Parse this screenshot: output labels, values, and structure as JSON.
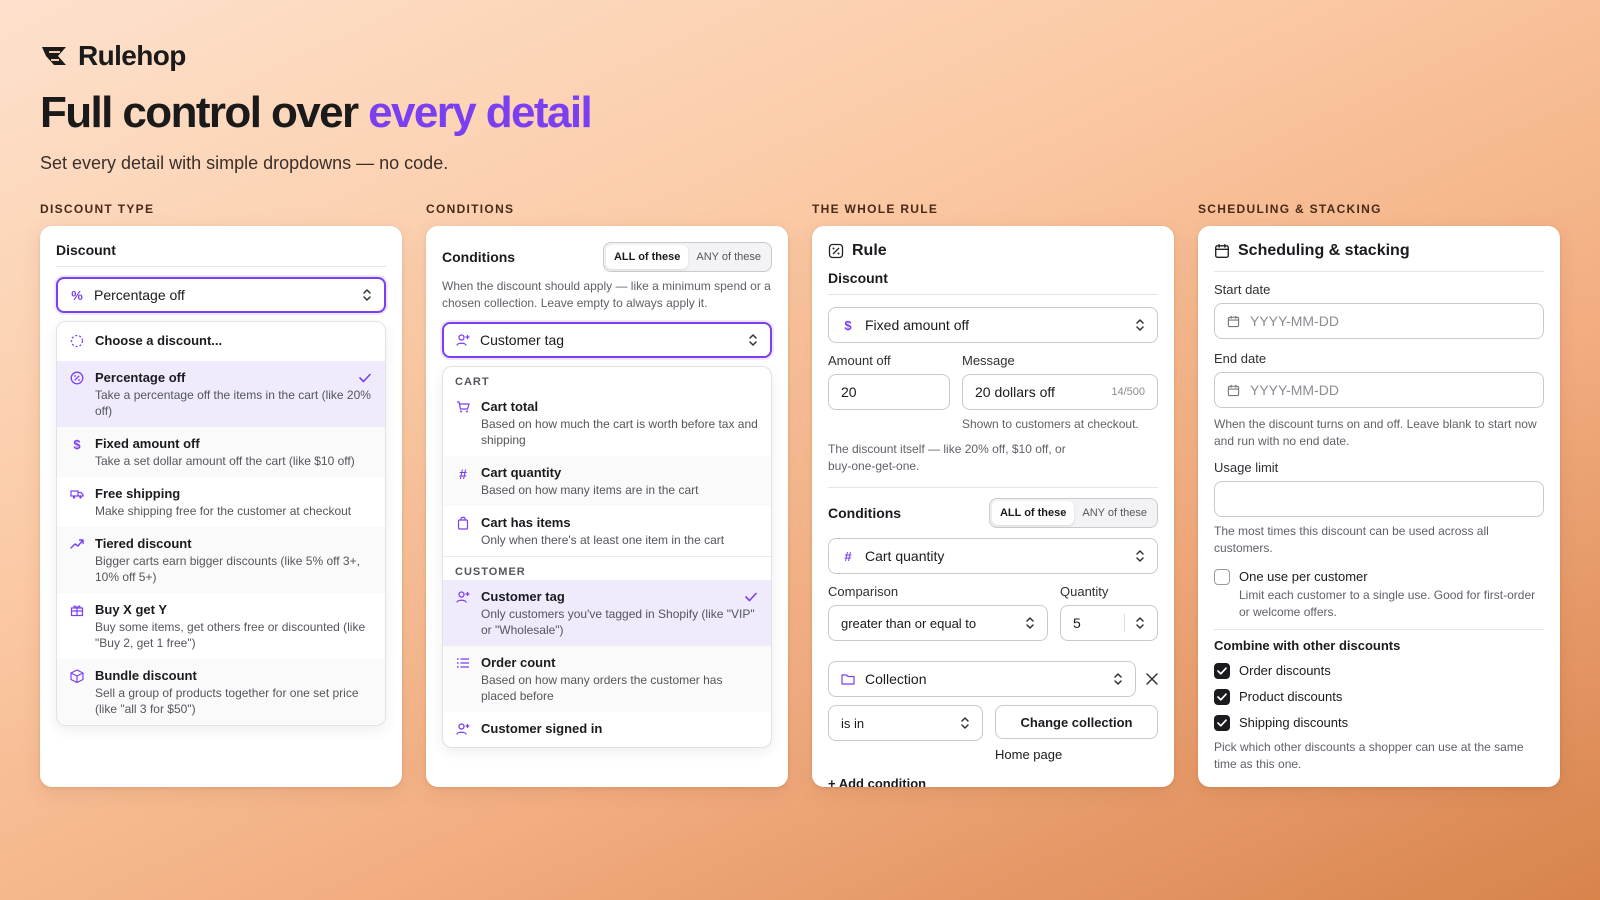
{
  "brand": {
    "name": "Rulehop"
  },
  "headline": {
    "lead": "Full control over",
    "accent": "every detail"
  },
  "subhead": "Set every detail with simple dropdowns — no code.",
  "colors": {
    "accent": "#7b3ff2",
    "selected_bg": "#f0eafd"
  },
  "discount_type": {
    "label": "DISCOUNT TYPE",
    "title": "Discount",
    "selected": "Percentage off",
    "placeholder_item": "Choose a discount...",
    "items": [
      {
        "title": "Percentage off",
        "desc": "Take a percentage off the items in the cart (like 20% off)",
        "icon": "percent-badge-icon",
        "selected": true
      },
      {
        "title": "Fixed amount off",
        "desc": "Take a set dollar amount off the cart (like $10 off)",
        "icon": "dollar-icon"
      },
      {
        "title": "Free shipping",
        "desc": "Make shipping free for the customer at checkout",
        "icon": "truck-icon"
      },
      {
        "title": "Tiered discount",
        "desc": "Bigger carts earn bigger discounts (like 5% off 3+, 10% off 5+)",
        "icon": "trend-up-icon"
      },
      {
        "title": "Buy X get Y",
        "desc": "Buy some items, get others free or discounted (like \"Buy 2, get 1 free\")",
        "icon": "gift-icon"
      },
      {
        "title": "Bundle discount",
        "desc": "Sell a group of products together for one set price (like \"all 3 for $50\")",
        "icon": "box-icon"
      }
    ]
  },
  "conditions": {
    "label": "CONDITIONS",
    "title": "Conditions",
    "seg_all": "ALL of these",
    "seg_any": "ANY of these",
    "desc": "When the discount should apply — like a minimum spend or a chosen collection. Leave empty to always apply it.",
    "selected": "Customer tag",
    "sec_cart": "CART",
    "sec_customer": "CUSTOMER",
    "cart_items": [
      {
        "title": "Cart total",
        "desc": "Based on how much the cart is worth before tax and shipping",
        "icon": "cart-icon"
      },
      {
        "title": "Cart quantity",
        "desc": "Based on how many items are in the cart",
        "icon": "hash-icon"
      },
      {
        "title": "Cart has items",
        "desc": "Only when there's at least one item in the cart",
        "icon": "bag-icon"
      }
    ],
    "customer_items": [
      {
        "title": "Customer tag",
        "desc": "Only customers you've tagged in Shopify (like \"VIP\" or \"Wholesale\")",
        "icon": "user-plus-icon",
        "selected": true
      },
      {
        "title": "Order count",
        "desc": "Based on how many orders the customer has placed before",
        "icon": "list-icon"
      },
      {
        "title": "Customer signed in",
        "desc": "",
        "icon": "user-plus-icon"
      }
    ]
  },
  "rule": {
    "label": "THE WHOLE RULE",
    "title": "Rule",
    "discount_title": "Discount",
    "discount_value": "Fixed amount off",
    "amount_label": "Amount off",
    "amount_value": "20",
    "message_label": "Message",
    "message_value": "20 dollars off",
    "message_count": "14/500",
    "message_help": "Shown to customers at checkout.",
    "discount_help": "The discount itself — like 20% off, $10 off, or buy-one-get-one.",
    "conditions_title": "Conditions",
    "seg_all": "ALL of these",
    "seg_any": "ANY of these",
    "cond1": "Cart quantity",
    "comparison_label": "Comparison",
    "comparison_value": "greater than or equal to",
    "quantity_label": "Quantity",
    "quantity_value": "5",
    "cond2": "Collection",
    "operator": "is in",
    "change_btn": "Change collection",
    "collection_value": "Home page",
    "add_condition": "+ Add condition"
  },
  "scheduling": {
    "label": "SCHEDULING & STACKING",
    "title": "Scheduling & stacking",
    "start_label": "Start date",
    "start_placeholder": "YYYY-MM-DD",
    "end_label": "End date",
    "end_placeholder": "YYYY-MM-DD",
    "date_help": "When the discount turns on and off. Leave blank to start now and run with no end date.",
    "usage_label": "Usage limit",
    "usage_help": "The most times this discount can be used across all customers.",
    "one_use_title": "One use per customer",
    "one_use_desc": "Limit each customer to a single use. Good for first-order or welcome offers.",
    "combine_title": "Combine with other discounts",
    "combine": [
      "Order discounts",
      "Product discounts",
      "Shipping discounts"
    ],
    "combine_help": "Pick which other discounts a shopper can use at the same time as this one."
  }
}
